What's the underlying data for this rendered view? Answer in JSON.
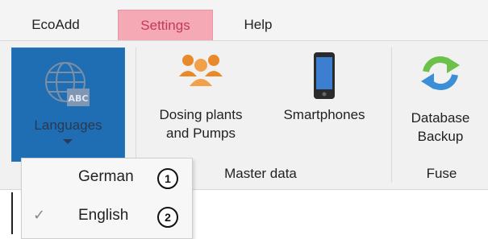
{
  "menubar": {
    "tabs": [
      {
        "label": "EcoAdd"
      },
      {
        "label": "Settings"
      },
      {
        "label": "Help"
      }
    ]
  },
  "ribbon": {
    "languages": {
      "label": "Languages",
      "icon": "globe-abc-icon"
    },
    "dosing": {
      "line1": "Dosing plants",
      "line2": "and Pumps",
      "icon": "people-group-icon"
    },
    "smartphones": {
      "label": "Smartphones",
      "icon": "smartphone-icon"
    },
    "database": {
      "line1": "Database",
      "line2": "Backup",
      "icon": "sync-arrows-icon"
    },
    "groups": {
      "master_data": "Master data",
      "fuse": "Fuse"
    }
  },
  "dropdown": {
    "items": [
      {
        "label": "German",
        "checked": false,
        "badge": "1"
      },
      {
        "label": "English",
        "checked": true,
        "check": "✓",
        "badge": "2"
      }
    ]
  },
  "colors": {
    "accent": "#1f6db3",
    "settings_tab": "#f4a9b4"
  }
}
